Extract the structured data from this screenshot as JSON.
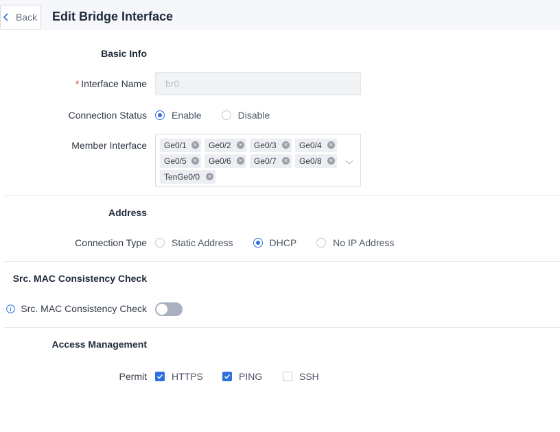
{
  "header": {
    "back_label": "Back",
    "title": "Edit Bridge Interface"
  },
  "basic_info": {
    "section_title": "Basic Info",
    "interface_name": {
      "label": "Interface Name",
      "required_mark": "*",
      "value": "br0"
    },
    "connection_status": {
      "label": "Connection Status",
      "options": [
        "Enable",
        "Disable"
      ],
      "selected": "Enable"
    },
    "member_interface": {
      "label": "Member Interface",
      "tags": [
        "Ge0/1",
        "Ge0/2",
        "Ge0/3",
        "Ge0/4",
        "Ge0/5",
        "Ge0/6",
        "Ge0/7",
        "Ge0/8",
        "TenGe0/0"
      ],
      "remove_glyph": "×"
    }
  },
  "address": {
    "section_title": "Address",
    "connection_type": {
      "label": "Connection Type",
      "options": [
        "Static Address",
        "DHCP",
        "No IP Address"
      ],
      "selected": "DHCP"
    }
  },
  "mac_check": {
    "section_title": "Src. MAC Consistency Check",
    "label": "Src. MAC Consistency Check",
    "enabled": false
  },
  "access_management": {
    "section_title": "Access Management",
    "permit": {
      "label": "Permit",
      "options": [
        {
          "label": "HTTPS",
          "checked": true
        },
        {
          "label": "PING",
          "checked": true
        },
        {
          "label": "SSH",
          "checked": false
        }
      ]
    }
  },
  "colors": {
    "accent": "#2f6fe0",
    "required": "#e53935",
    "toggle_off": "#a9b1bf"
  }
}
